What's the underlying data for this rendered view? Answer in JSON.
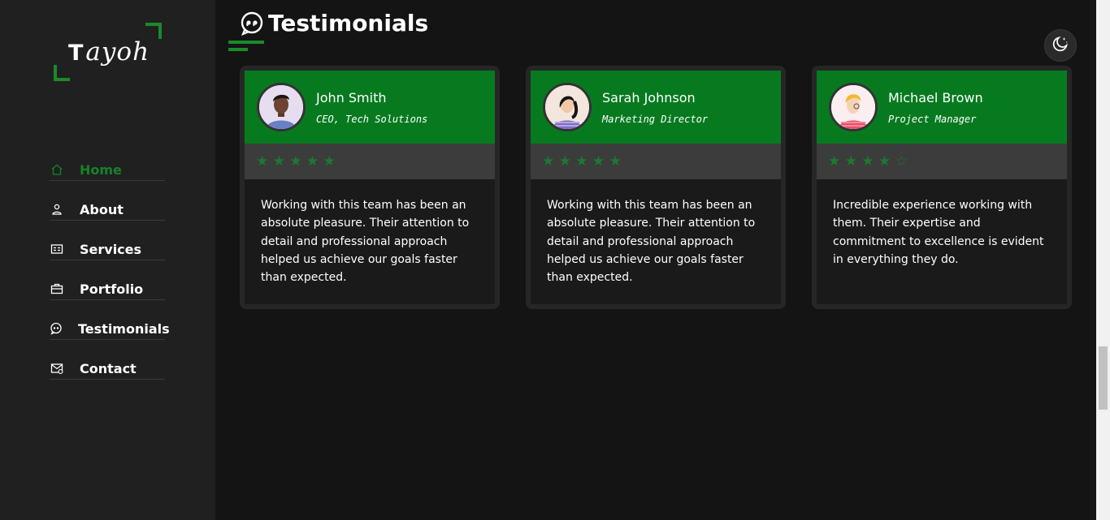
{
  "logo": {
    "cap": "T",
    "rest": "ayoh"
  },
  "nav": {
    "items": [
      {
        "label": "Home",
        "icon": "home-icon",
        "active": true
      },
      {
        "label": "About",
        "icon": "user-icon"
      },
      {
        "label": "Services",
        "icon": "id-card-icon"
      },
      {
        "label": "Portfolio",
        "icon": "briefcase-icon"
      },
      {
        "label": "Testimonials",
        "icon": "quote-bubble-icon"
      },
      {
        "label": "Contact",
        "icon": "mail-icon"
      }
    ]
  },
  "section": {
    "title": "Testimonials",
    "icon": "quote-bubble-icon"
  },
  "theme_toggle": {
    "icon": "moon-stars-icon"
  },
  "colors": {
    "accent": "#077a20",
    "star": "#1b7a2e",
    "background": "#141414",
    "sidebar": "#202020"
  },
  "testimonials": [
    {
      "name": "John Smith",
      "role": "CEO, Tech Solutions",
      "rating": 5,
      "stars": "★ ★ ★ ★ ★",
      "text": "Working with this team has been an absolute pleasure. Their attention to detail and professional approach helped us achieve our goals faster than expected."
    },
    {
      "name": "Sarah Johnson",
      "role": "Marketing Director",
      "rating": 5,
      "stars": "★ ★ ★ ★ ★",
      "text": "Working with this team has been an absolute pleasure. Their attention to detail and professional approach helped us achieve our goals faster than expected."
    },
    {
      "name": "Michael Brown",
      "role": "Project Manager",
      "rating": 4,
      "stars": "★ ★ ★ ★ ☆",
      "text": "Incredible experience working with them. Their expertise and commitment to excellence is evident in everything they do."
    }
  ]
}
